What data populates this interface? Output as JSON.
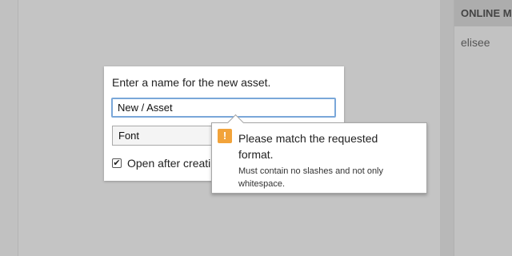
{
  "side_panel": {
    "header": "ONLINE M",
    "user": "elisee"
  },
  "dialog": {
    "title": "Enter a name for the new asset.",
    "name_value": "New / Asset",
    "type_value": "Font",
    "open_after_label": "Open after creati"
  },
  "tooltip": {
    "icon": "!",
    "title": "Please match the requested format.",
    "detail": "Must contain no slashes and not only whitespace."
  },
  "colors": {
    "warning": "#f2a33a",
    "input_focus": "#7aa7d9"
  }
}
